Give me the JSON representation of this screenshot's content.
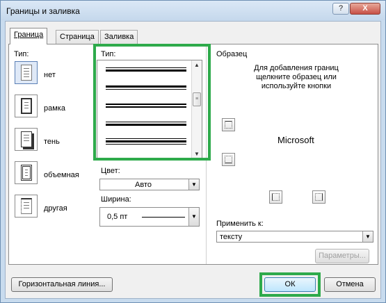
{
  "window": {
    "title": "Границы и заливка",
    "help_button": "?",
    "close_button": "X"
  },
  "tabs": [
    {
      "label": "Граница",
      "active": true
    },
    {
      "label": "Страница",
      "active": false
    },
    {
      "label": "Заливка",
      "active": false
    }
  ],
  "setting": {
    "label": "Тип:",
    "items": [
      {
        "label": "нет",
        "icon": "border-none-icon"
      },
      {
        "label": "рамка",
        "icon": "border-box-icon"
      },
      {
        "label": "тень",
        "icon": "border-shadow-icon"
      },
      {
        "label": "объемная",
        "icon": "border-3d-icon"
      },
      {
        "label": "другая",
        "icon": "border-custom-icon"
      }
    ]
  },
  "style": {
    "label": "Тип:",
    "items": [
      "double-thin-thick",
      "thick-thin",
      "double-medium",
      "thick-double",
      "triple"
    ]
  },
  "color": {
    "label": "Цвет:",
    "value": "Авто"
  },
  "width": {
    "label": "Ширина:",
    "value": "0,5 пт"
  },
  "preview": {
    "label": "Образец",
    "hint": "Для добавления границ щелкните образец или используйте кнопки",
    "sample_text": "Microsoft"
  },
  "apply_to": {
    "label": "Применить к:",
    "value": "тексту"
  },
  "buttons": {
    "options": "Параметры...",
    "horizontal_line": "Горизонтальная линия...",
    "ok": "ОК",
    "cancel": "Отмена"
  },
  "colors": {
    "highlight": "#2eaa4b",
    "titlebar": "#c5d8ec"
  }
}
